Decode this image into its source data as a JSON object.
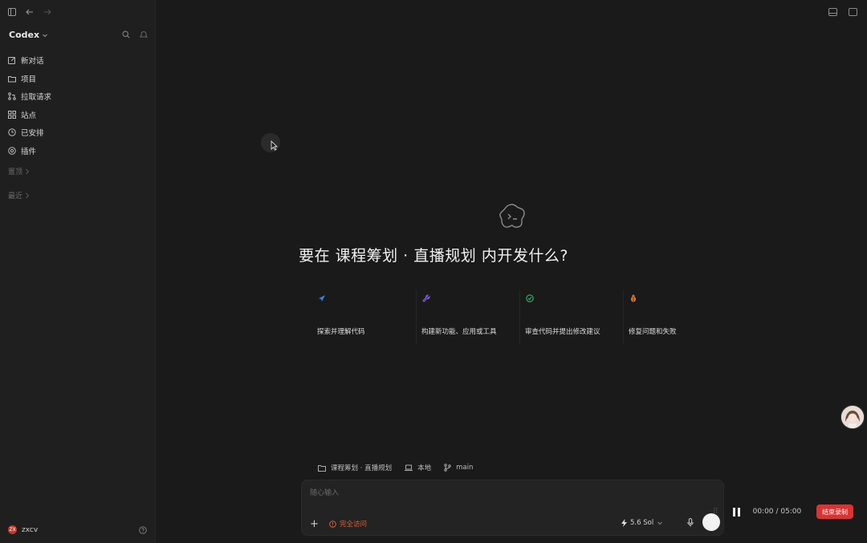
{
  "sidebar": {
    "brand": "Codex",
    "nav": [
      {
        "label": "新对话",
        "icon": "edit-icon"
      },
      {
        "label": "项目",
        "icon": "folder-icon"
      },
      {
        "label": "拉取请求",
        "icon": "pull-request-icon"
      },
      {
        "label": "站点",
        "icon": "grid-icon"
      },
      {
        "label": "已安排",
        "icon": "clock-icon"
      },
      {
        "label": "插件",
        "icon": "plugin-icon"
      }
    ],
    "sections": {
      "pinned": "置顶",
      "recent": "最近"
    },
    "user": {
      "name": "zxcv",
      "initials": "ZX"
    }
  },
  "main": {
    "title_prefix": "要在",
    "project": "课程筹划 · 直播规划",
    "title_suffix": "内开发什么?",
    "cards": [
      {
        "icon": "compass-icon",
        "color": "#3d7fe0",
        "text": "探索并理解代码"
      },
      {
        "icon": "tool-icon",
        "color": "#8a5cf0",
        "text": "构建新功能、应用或工具"
      },
      {
        "icon": "review-icon",
        "color": "#3bb56a",
        "text": "审查代码并提出修改建议"
      },
      {
        "icon": "bug-icon",
        "color": "#e07a2f",
        "text": "修复问题和失败"
      }
    ],
    "context": {
      "folder": "课程筹划 · 直播规划",
      "env": "本地",
      "branch": "main"
    },
    "composer": {
      "placeholder": "随心输入",
      "access": "完全访问",
      "model": "5.6 Sol"
    }
  },
  "recorder": {
    "elapsed": "00:00",
    "total": "05:00",
    "stop_label": "结束录制"
  },
  "colors": {
    "accent_danger": "#d83434",
    "access_orange": "#e0603a",
    "background": "#1a1a1a",
    "sidebar": "#1f1f1f"
  }
}
